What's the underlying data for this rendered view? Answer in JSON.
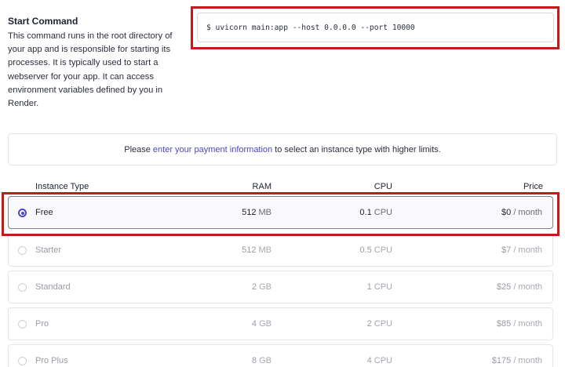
{
  "start_command": {
    "title": "Start Command",
    "description": "This command runs in the root directory of your app and is responsible for starting its processes. It is typically used to start a webserver for your app. It can access environment variables defined by you in Render.",
    "value": "$ uvicorn main:app --host 0.0.0.0 --port 10000"
  },
  "payment_banner": {
    "prefix": "Please",
    "link": "enter your payment information",
    "suffix": "to select an instance type with higher limits."
  },
  "instance_table": {
    "headers": {
      "type": "Instance Type",
      "ram": "RAM",
      "cpu": "CPU",
      "price": "Price"
    },
    "rows": [
      {
        "name": "Free",
        "ram_value": "512",
        "ram_unit": "MB",
        "cpu_value": "0.1",
        "cpu_unit": "CPU",
        "price_value": "$0",
        "price_unit": "/ month",
        "selected": true
      },
      {
        "name": "Starter",
        "ram_value": "512",
        "ram_unit": "MB",
        "cpu_value": "0.5",
        "cpu_unit": "CPU",
        "price_value": "$7",
        "price_unit": "/ month",
        "selected": false
      },
      {
        "name": "Standard",
        "ram_value": "2",
        "ram_unit": "GB",
        "cpu_value": "1",
        "cpu_unit": "CPU",
        "price_value": "$25",
        "price_unit": "/ month",
        "selected": false
      },
      {
        "name": "Pro",
        "ram_value": "4",
        "ram_unit": "GB",
        "cpu_value": "2",
        "cpu_unit": "CPU",
        "price_value": "$85",
        "price_unit": "/ month",
        "selected": false
      },
      {
        "name": "Pro Plus",
        "ram_value": "8",
        "ram_unit": "GB",
        "cpu_value": "4",
        "cpu_unit": "CPU",
        "price_value": "$175",
        "price_unit": "/ month",
        "selected": false
      }
    ]
  },
  "colors": {
    "accent": "#4f46c8",
    "highlight_frame": "#c51a1a"
  }
}
